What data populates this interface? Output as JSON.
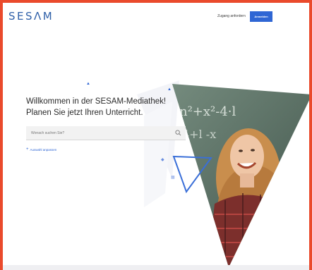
{
  "header": {
    "logo": "SESΛM",
    "request_access_label": "Zugang anfordern",
    "login_label": "Anmelden"
  },
  "hero": {
    "headline_line1": "Willkommen in der SESAM-Mediathek!",
    "headline_line2": "Planen Sie jetzt Ihren Unterricht.",
    "search_placeholder": "Wonach suchen Sie?",
    "filter_label": "Auswahl anpassen"
  },
  "colors": {
    "accent": "#2f66d4",
    "logo": "#2e5fa8",
    "frame": "#ea4a2c"
  },
  "icons": [
    "search-icon",
    "plus-icon",
    "play-triangle-icon"
  ]
}
